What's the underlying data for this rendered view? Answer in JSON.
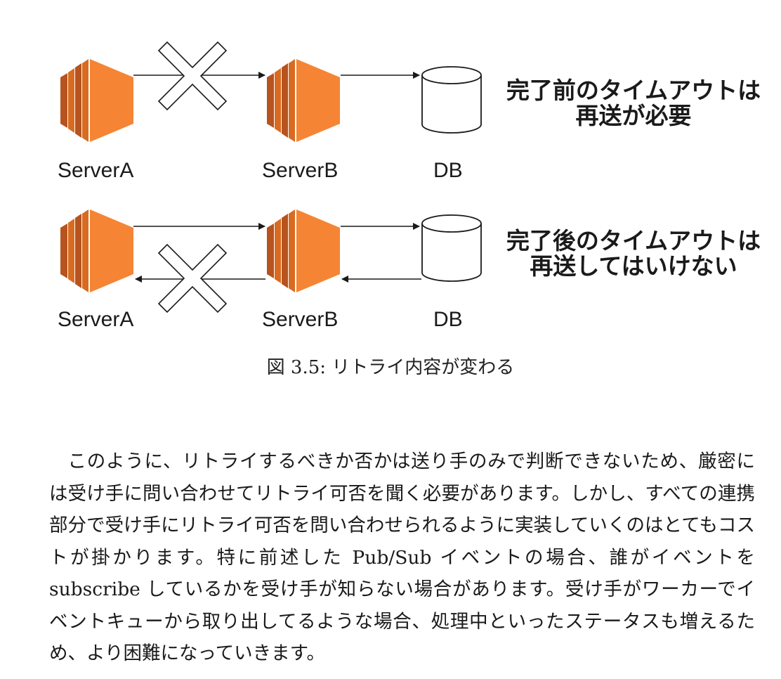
{
  "figure": {
    "rows": [
      {
        "labels": [
          "ServerA",
          "ServerB",
          "DB"
        ],
        "note_lines": [
          "完了前のタイムアウトは",
          "再送が必要"
        ]
      },
      {
        "labels": [
          "ServerA",
          "ServerB",
          "DB"
        ],
        "note_lines": [
          "完了後のタイムアウトは",
          "再送してはいけない"
        ]
      }
    ],
    "colors": {
      "server_dark": "#b6531f",
      "server_mid": "#d86b20",
      "server_main": "#f58534",
      "line": "#1a1a1a"
    },
    "icons": [
      "server-icon",
      "database-icon",
      "cross-mark-icon"
    ]
  },
  "caption": "図 3.5: リトライ内容が変わる",
  "paragraph": "このように、リトライするべきか否かは送り手のみで判断できないため、厳密には受け手に問い合わせてリトライ可否を聞く必要があります。しかし、すべての連携部分で受け手にリトライ可否を問い合わせられるように実装していくのはとてもコストが掛かります。特に前述した Pub/Sub イベントの場合、誰がイベントを subscribe しているかを受け手が知らない場合があります。受け手がワーカーでイベントキューから取り出してるような場合、処理中といったステータスも増えるため、より困難になっていきます。"
}
